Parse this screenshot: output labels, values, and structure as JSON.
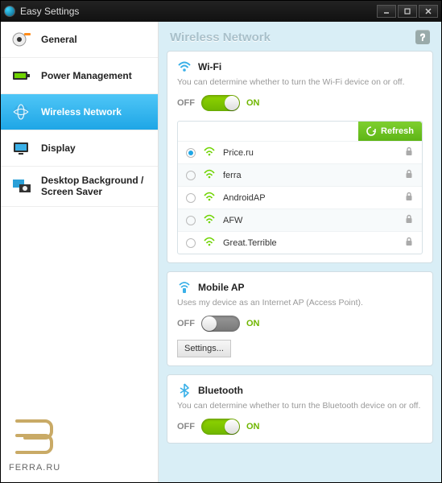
{
  "window": {
    "title": "Easy Settings"
  },
  "sidebar": {
    "items": [
      {
        "label": "General"
      },
      {
        "label": "Power Management"
      },
      {
        "label": "Wireless Network"
      },
      {
        "label": "Display"
      },
      {
        "label": "Desktop Background / Screen Saver"
      }
    ]
  },
  "content": {
    "header": "Wireless Network",
    "help": "?"
  },
  "wifi": {
    "title": "Wi-Fi",
    "desc": "You can determine whether to turn the Wi-Fi device on or off.",
    "off_label": "OFF",
    "on_label": "ON",
    "state": "on",
    "refresh_label": "Refresh",
    "networks": [
      {
        "name": "Price.ru",
        "selected": true,
        "secured": true
      },
      {
        "name": "ferra",
        "selected": false,
        "secured": true
      },
      {
        "name": "AndroidAP",
        "selected": false,
        "secured": true
      },
      {
        "name": "AFW",
        "selected": false,
        "secured": true
      },
      {
        "name": "Great.Terrible",
        "selected": false,
        "secured": true
      }
    ]
  },
  "mobile_ap": {
    "title": "Mobile AP",
    "desc": "Uses my device as an Internet AP (Access Point).",
    "off_label": "OFF",
    "on_label": "ON",
    "state": "off",
    "settings_label": "Settings..."
  },
  "bluetooth": {
    "title": "Bluetooth",
    "desc": "You can determine whether to turn the Bluetooth device on or off.",
    "off_label": "OFF",
    "on_label": "ON",
    "state": "on"
  },
  "watermark": {
    "text": "FERRA.RU"
  }
}
